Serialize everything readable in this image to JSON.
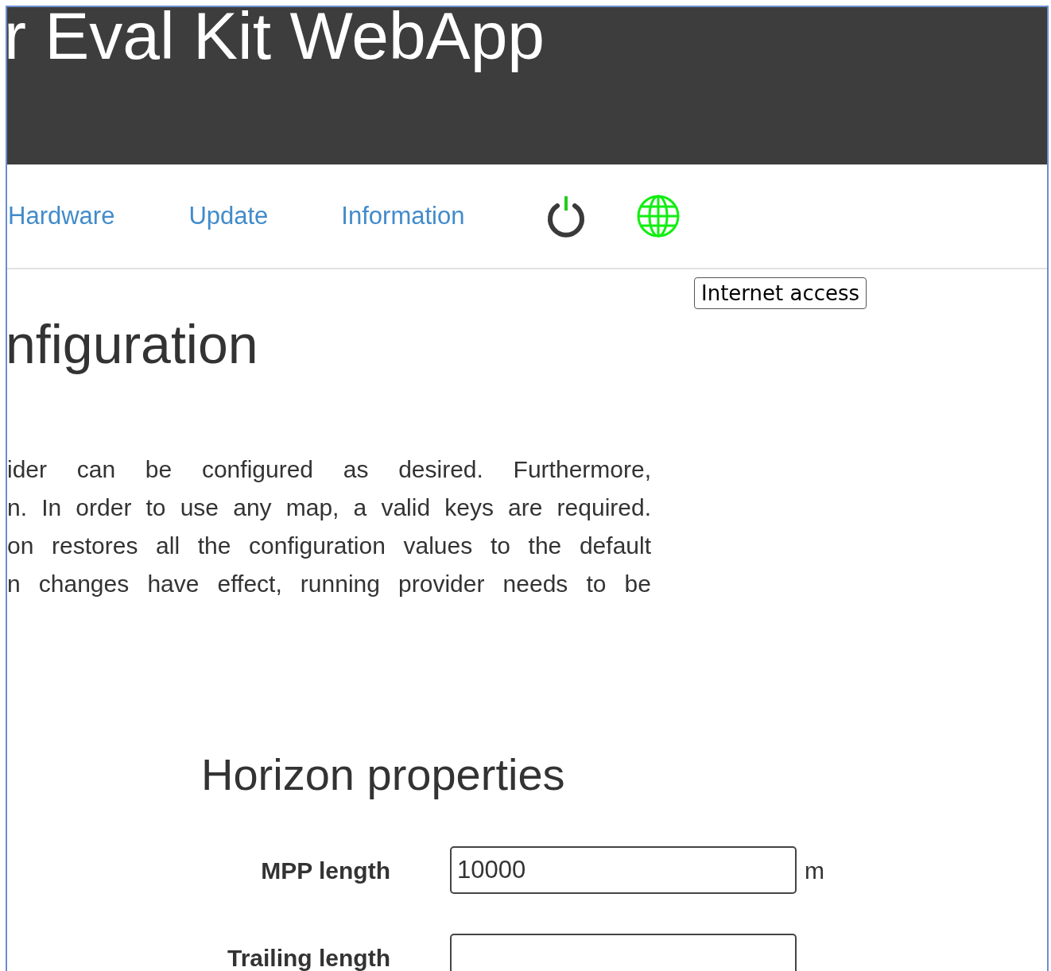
{
  "header": {
    "title": "r Eval Kit WebApp"
  },
  "nav": {
    "links": [
      {
        "label": "Hardware"
      },
      {
        "label": "Update"
      },
      {
        "label": "Information"
      }
    ],
    "internet_connected": true,
    "tooltip": "Internet access"
  },
  "page": {
    "heading": "nfiguration",
    "paragraph_lines": [
      "ider can be configured as desired. Furthermore,",
      "n. In order to use any map, a valid keys are required.",
      "on restores all the configuration values to the default",
      "n changes have effect, running provider needs to be"
    ]
  },
  "section": {
    "heading": "Horizon properties",
    "fields": [
      {
        "label": "MPP length",
        "value": "10000",
        "unit": "m"
      },
      {
        "label": "Trailing length"
      }
    ]
  }
}
